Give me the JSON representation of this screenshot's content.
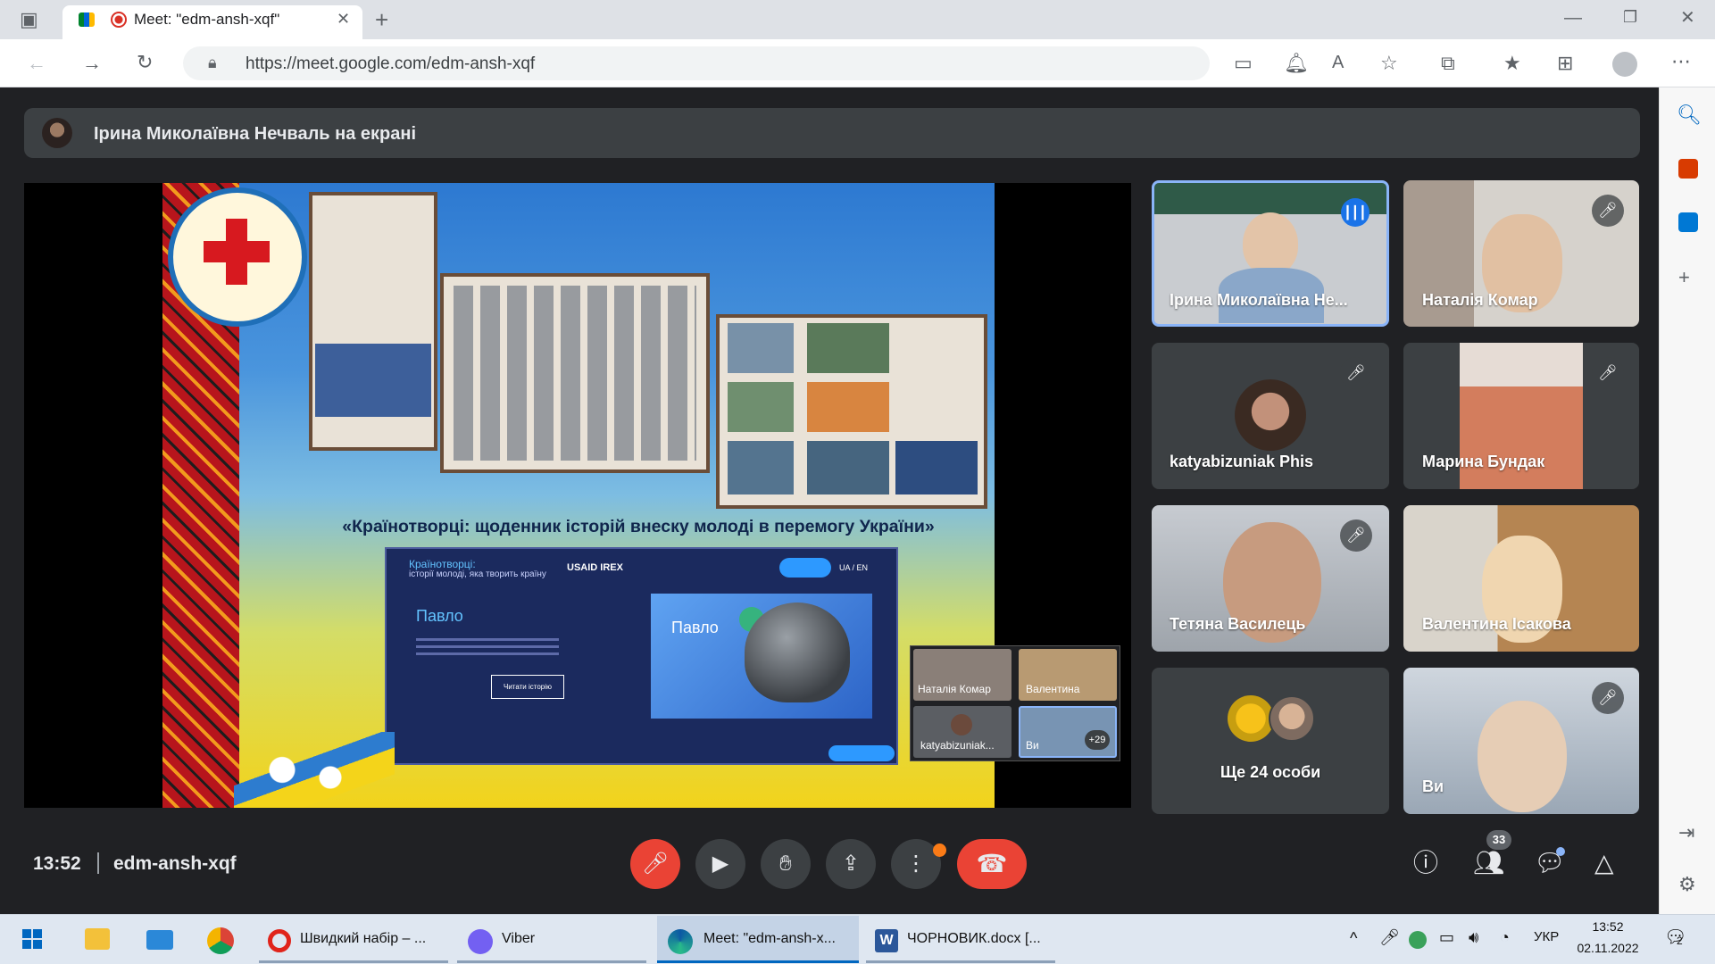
{
  "browser": {
    "tab_title": "Meet: \"edm-ansh-xqf\"",
    "new_tab": "+",
    "url": "https://meet.google.com/edm-ansh-xqf"
  },
  "meet": {
    "presenter_banner": "Ірина Миколаївна Нечваль на екрані",
    "slide": {
      "caption": "«Країнотворці: щоденник історій внеску молоді в перемогу України»",
      "web_title": "Країнотворці:",
      "web_subtitle": "історії молоді, яка творить країну",
      "web_logos": "USAID   IREX",
      "web_lang": "UA / EN",
      "name_left": "Павло",
      "name_card": "Павло",
      "read_story_btn": "Читати історію",
      "mini_grid": {
        "tile1": "Наталія Комар",
        "tile2": "Валентина",
        "tile3": "katyabizuniak...",
        "tile4": "Ви",
        "more": "+29"
      }
    },
    "tiles": [
      {
        "name": "Ірина Миколаївна Не...",
        "muted": false,
        "speaking": true
      },
      {
        "name": "Наталія Комар",
        "muted": true
      },
      {
        "name": "katyabizuniak Phis",
        "muted": true
      },
      {
        "name": "Марина Бундак",
        "muted": true
      },
      {
        "name": "Тетяна Василець",
        "muted": true
      },
      {
        "name": "Валентина Ісакова",
        "muted": false
      },
      {
        "name": "Ще 24 особи"
      },
      {
        "name": "Ви",
        "muted": true
      }
    ],
    "clock": "13:52",
    "meeting_code": "edm-ansh-xqf",
    "people_count": "33"
  },
  "taskbar": {
    "items": [
      {
        "label": "Швидкий набір – ..."
      },
      {
        "label": "Viber"
      },
      {
        "label": "Meet: \"edm-ansh-x..."
      },
      {
        "label": "ЧОРНОВИК.docx [..."
      }
    ],
    "language": "УКР",
    "time": "13:52",
    "date": "02.11.2022",
    "notifications": "2"
  },
  "colors": {
    "meet_bg": "#202124",
    "tile_bg": "#3c4043",
    "danger": "#ea4335",
    "accent": "#8ab4f8",
    "taskbar": "#dfe7f1"
  }
}
